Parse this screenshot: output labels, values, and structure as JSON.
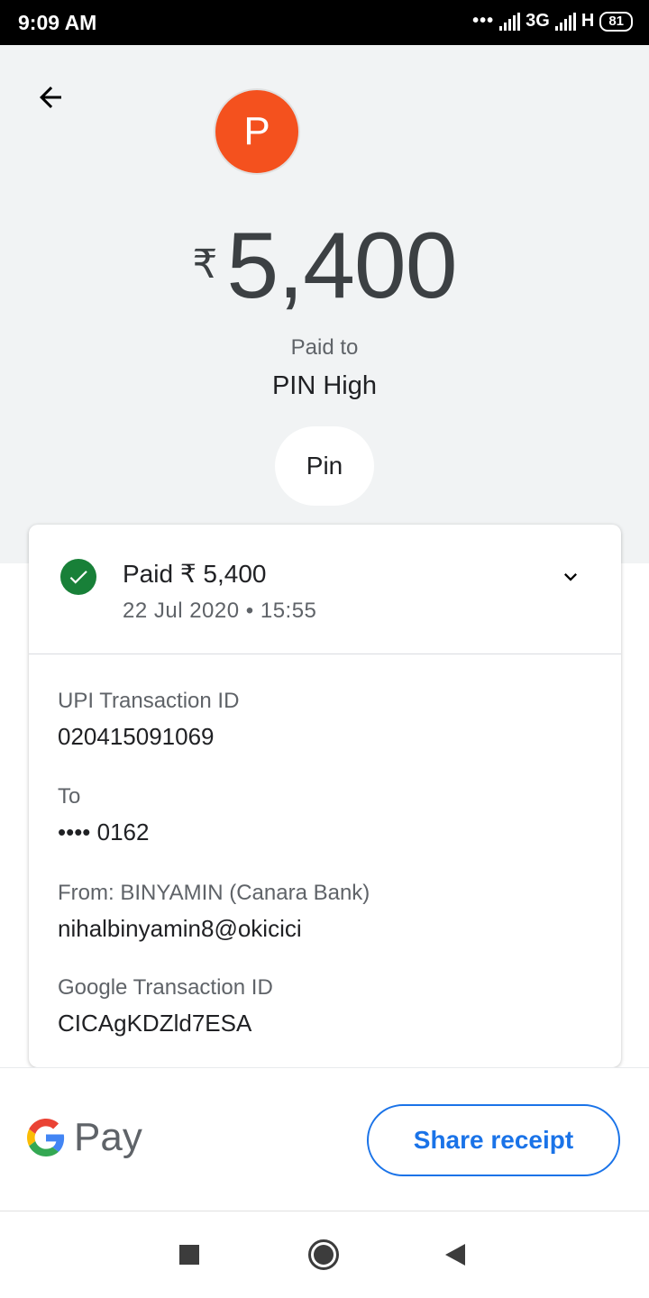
{
  "status_bar": {
    "time": "9:09 AM",
    "network_1": "3G",
    "network_2": "H",
    "battery": "81"
  },
  "header": {
    "avatar_letter": "P",
    "currency_symbol": "₹",
    "amount": "5,400",
    "paid_to_label": "Paid to",
    "payee_name": "PIN High",
    "chip_label": "Pin"
  },
  "transaction": {
    "status_text": "Paid ₹ 5,400",
    "date": "22 Jul 2020 • 15:55",
    "status_color": "#188038",
    "details": [
      {
        "label": "UPI Transaction ID",
        "value": "020415091069"
      },
      {
        "label": "To",
        "value": "•••• 0162"
      },
      {
        "label": "From: BINYAMIN (Canara Bank)",
        "value": "nihalbinyamin8@okicici"
      },
      {
        "label": "Google Transaction ID",
        "value": "CICAgKDZld7ESA"
      }
    ]
  },
  "footer": {
    "brand_text": "Pay",
    "share_label": "Share receipt",
    "accent_color": "#1a73e8"
  },
  "icons": {
    "back": "arrow-left-icon",
    "check": "check-circle-icon",
    "expand": "chevron-down-icon",
    "logo": "google-g-icon"
  }
}
